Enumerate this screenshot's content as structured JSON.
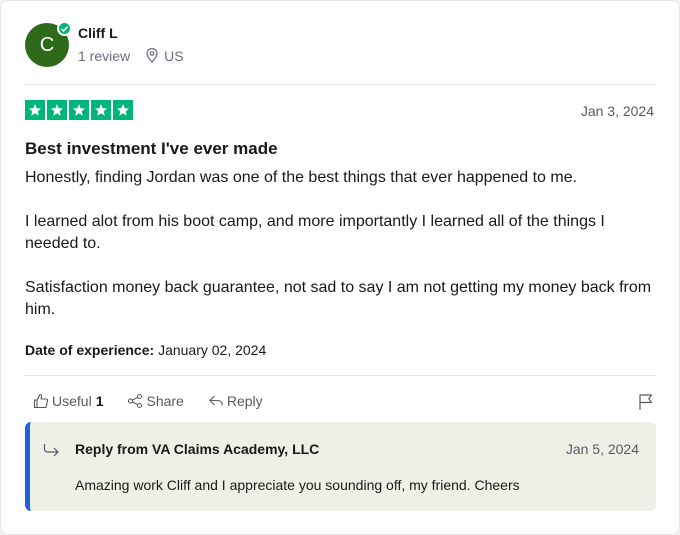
{
  "consumer": {
    "initial": "C",
    "name": "Cliff L",
    "reviews": "1 review",
    "location": "US",
    "avatar_color": "#2f6a1b"
  },
  "review": {
    "rating": 5,
    "star_color": "#00b67a",
    "date": "Jan 3, 2024",
    "title": "Best investment I've ever made",
    "paragraphs": [
      "Honestly, finding Jordan was one of the best things that ever happened to me.",
      "I learned alot from his boot camp, and more importantly I learned all of the things I needed to.",
      "Satisfaction money back guarantee, not sad to say I am not getting my money back from him."
    ],
    "experience_label": "Date of experience:",
    "experience_date": "January 02, 2024"
  },
  "actions": {
    "useful_label": "Useful",
    "useful_count": "1",
    "share_label": "Share",
    "reply_label": "Reply"
  },
  "reply": {
    "from": "Reply from VA Claims Academy, LLC",
    "date": "Jan 5, 2024",
    "text": "Amazing work Cliff and I appreciate you sounding off, my friend. Cheers",
    "accent_color": "#1f63d8"
  }
}
